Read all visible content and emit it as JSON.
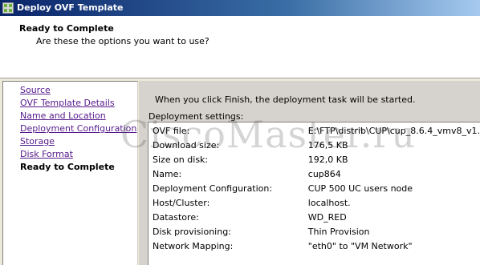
{
  "window": {
    "title": "Deploy OVF Template",
    "icon": "vsphere-logo-icon"
  },
  "header": {
    "heading": "Ready to Complete",
    "subheading": "Are these the options you want to use?"
  },
  "sidebar": {
    "items": [
      {
        "label": "Source",
        "state": "completed"
      },
      {
        "label": "OVF Template Details",
        "state": "completed"
      },
      {
        "label": "Name and Location",
        "state": "completed"
      },
      {
        "label": "Deployment Configuration",
        "state": "completed"
      },
      {
        "label": "Storage",
        "state": "completed"
      },
      {
        "label": "Disk Format",
        "state": "completed"
      },
      {
        "label": "Ready to Complete",
        "state": "current"
      }
    ]
  },
  "main": {
    "intro": "When you click Finish, the deployment task will be started.",
    "settings_label": "Deployment settings:",
    "settings": [
      {
        "key": "OVF file:",
        "value": "E:\\FTP\\distrib\\CUP\\cup_8.6.4_vmv8_v1."
      },
      {
        "key": "Download size:",
        "value": "176,5 KB"
      },
      {
        "key": "Size on disk:",
        "value": "192,0 KB"
      },
      {
        "key": "Name:",
        "value": "cup864"
      },
      {
        "key": "Deployment Configuration:",
        "value": "CUP 500 UC users node"
      },
      {
        "key": "Host/Cluster:",
        "value": "localhost."
      },
      {
        "key": "Datastore:",
        "value": "WD_RED"
      },
      {
        "key": "Disk provisioning:",
        "value": "Thin Provision"
      },
      {
        "key": "Network Mapping:",
        "value": "\"eth0\" to \"VM Network\""
      }
    ]
  },
  "watermark": "CiscoMaster.ru",
  "colors": {
    "titlebar_start": "#0a246a",
    "titlebar_end": "#a6caf0",
    "link": "#551a8b",
    "panel": "#d6d3ce"
  }
}
